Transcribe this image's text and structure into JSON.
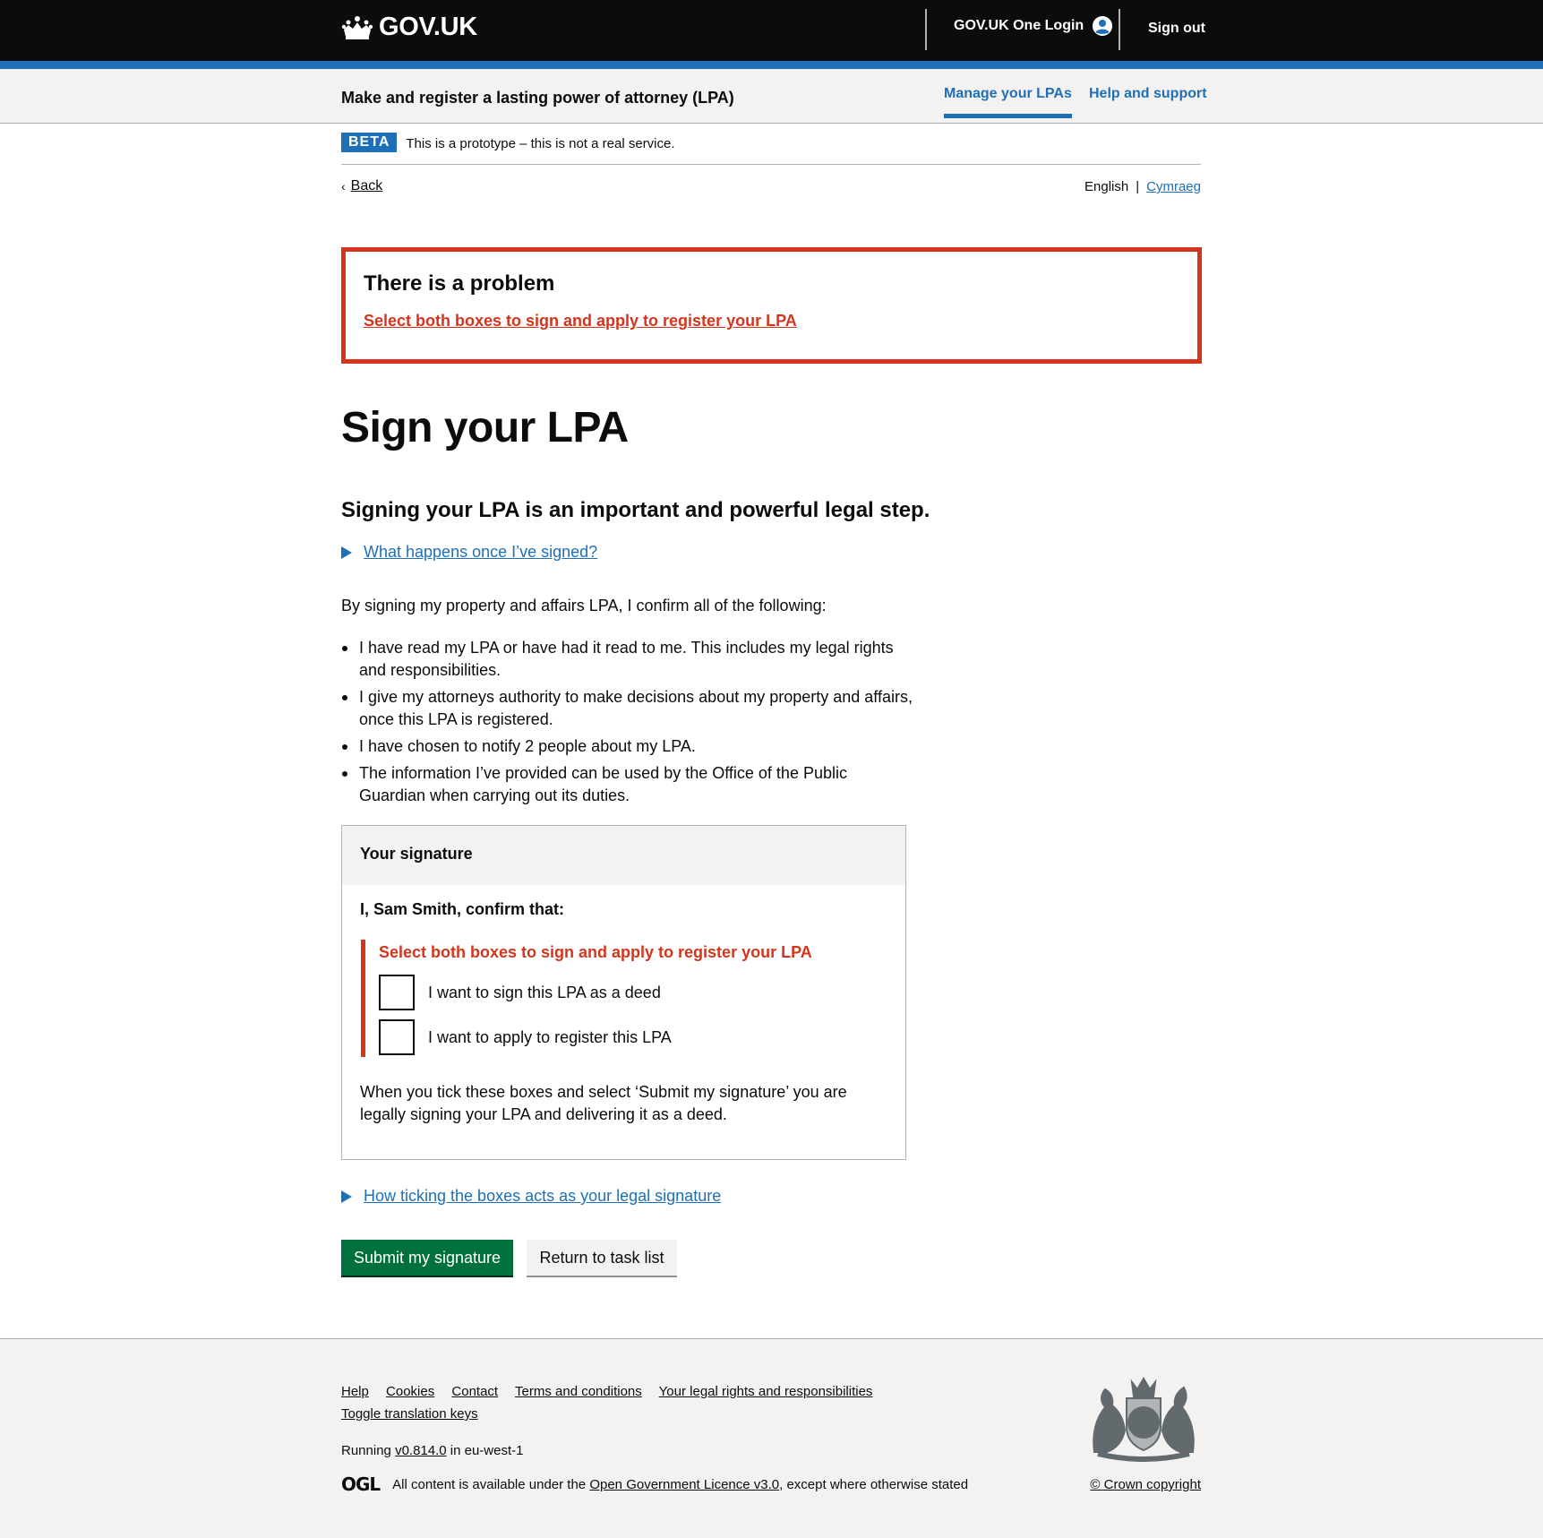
{
  "header": {
    "logo_text": "GOV.UK",
    "one_login": "GOV.UK One Login",
    "sign_out": "Sign out"
  },
  "service": {
    "name": "Make and register a lasting power of attorney (LPA)",
    "nav": [
      "Manage your LPAs",
      "Help and support"
    ]
  },
  "banner": {
    "tag": "BETA",
    "message": "This is a prototype – this is not a real service."
  },
  "back_label": "Back",
  "language": {
    "english": "English",
    "separator": "|",
    "welsh": "Cymraeg"
  },
  "error_summary": {
    "title": "There is a problem",
    "link": "Select both boxes to sign and apply to register your LPA"
  },
  "page_title": "Sign your LPA",
  "lead": "Signing your LPA is an important and powerful legal step.",
  "details_1": "What happens once I’ve signed?",
  "intro": "By signing my property and affairs LPA, I confirm all of the following:",
  "bullets": [
    "I have read my LPA or have had it read to me. This includes my legal rights and responsibilities.",
    "I give my attorneys authority to make decisions about my property and affairs, once this LPA is registered.",
    "I have chosen to notify 2 people about my LPA.",
    "The information I’ve provided can be used by the Office of the Public Guardian when carrying out its duties."
  ],
  "signature": {
    "heading": "Your signature",
    "confirm": "I, Sam Smith, confirm that:",
    "error": "Select both boxes to sign and apply to register your LPA",
    "checkbox_1": "I want to sign this LPA as a deed",
    "checkbox_2": "I want to apply to register this LPA",
    "note": "When you tick these boxes and select ‘Submit my signature’ you are legally signing your LPA and delivering it as a deed."
  },
  "details_2": "How ticking the boxes acts as your legal signature",
  "buttons": {
    "submit": "Submit my signature",
    "return": "Return to task list"
  },
  "footer": {
    "links": [
      "Help",
      "Cookies",
      "Contact",
      "Terms and conditions",
      "Your legal rights and responsibilities",
      "Toggle translation keys"
    ],
    "running_prefix": "Running",
    "version": "v0.814.0",
    "running_suffix": "in eu-west-1",
    "ogl": "OGL",
    "licence_prefix": "All content is available under the",
    "licence_link": "Open Government Licence v3.0",
    "licence_suffix": ", except where otherwise stated",
    "copyright": "© Crown copyright"
  },
  "colors": {
    "header": "#0b0c0c",
    "brand_blue": "#1d70b8",
    "error_red": "#d4351c",
    "primary_green": "#00703c",
    "panel_grey": "#f3f2f1"
  }
}
